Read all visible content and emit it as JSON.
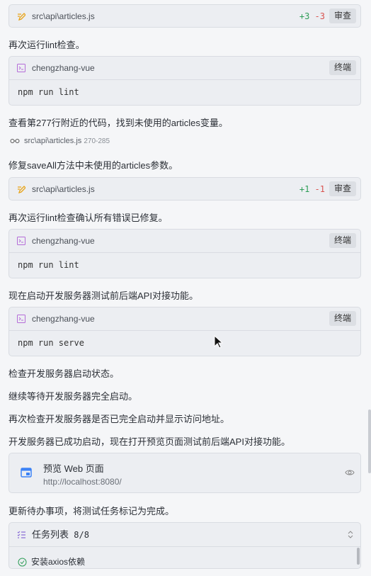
{
  "edit1": {
    "path": "src\\api\\articles.js",
    "added": "+3",
    "removed": "-3",
    "button": "审查"
  },
  "msg1": "再次运行lint检查。",
  "term1": {
    "title": "chengzhang-vue",
    "button": "终端",
    "command": "npm run lint"
  },
  "msg2": "查看第277行附近的代码，找到未使用的articles变量。",
  "read1": {
    "path": "src\\api\\articles.js",
    "range": "270-285"
  },
  "msg3": "修复saveAll方法中未使用的articles参数。",
  "edit2": {
    "path": "src\\api\\articles.js",
    "added": "+1",
    "removed": "-1",
    "button": "审查"
  },
  "msg4": "再次运行lint检查确认所有错误已修复。",
  "term2": {
    "title": "chengzhang-vue",
    "button": "终端",
    "command": "npm run lint"
  },
  "msg5": "现在启动开发服务器测试前后端API对接功能。",
  "term3": {
    "title": "chengzhang-vue",
    "button": "终端",
    "command": "npm run serve"
  },
  "msg6": "检查开发服务器启动状态。",
  "msg7": "继续等待开发服务器完全启动。",
  "msg8": "再次检查开发服务器是否已完全启动并显示访问地址。",
  "msg9": "开发服务器已成功启动，现在打开预览页面测试前后端API对接功能。",
  "preview": {
    "title": "预览 Web 页面",
    "url": "http://localhost:8080/"
  },
  "msg10": "更新待办事项，将测试任务标记为完成。",
  "tasks": {
    "title": "任务列表",
    "count": "8/8",
    "first_item": "安装axios依赖"
  },
  "colors": {
    "accent": "#3b82f6",
    "add": "#2e9d57",
    "remove": "#d9534f"
  },
  "icons": {
    "edit": "pencil-icon",
    "terminal": "terminal-icon",
    "read": "glasses-icon",
    "preview": "browser-window-icon",
    "eye": "eye-icon",
    "tasks": "checklist-icon",
    "check": "check-circle-icon"
  }
}
